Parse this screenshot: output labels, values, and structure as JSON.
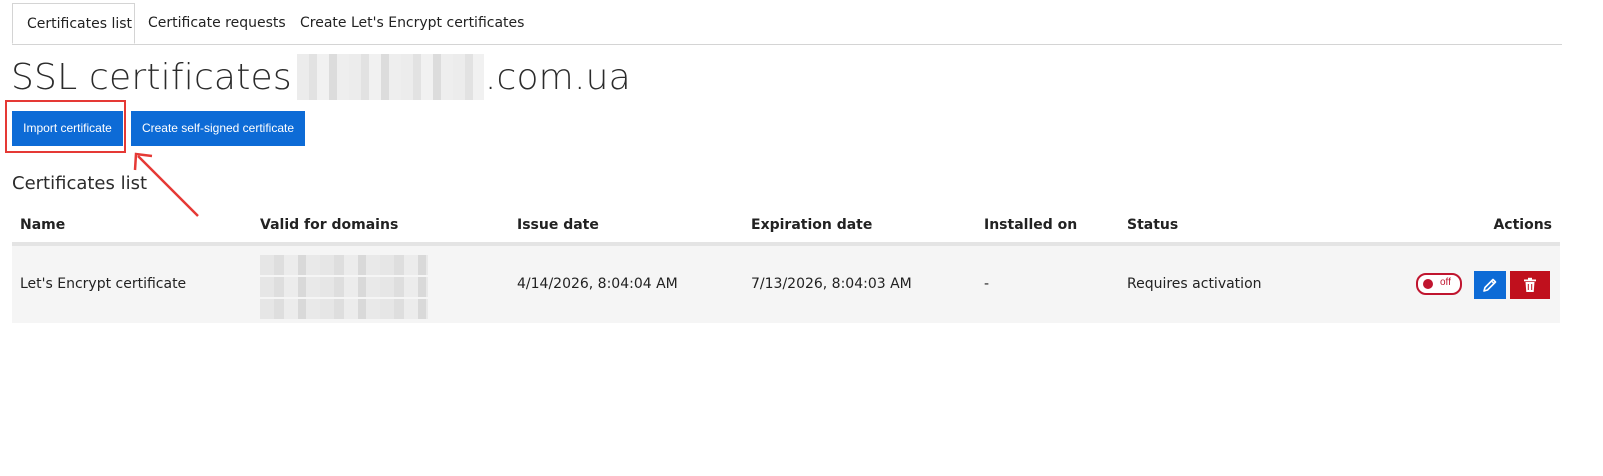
{
  "tabs": [
    {
      "label": "Certificates list",
      "active": true
    },
    {
      "label": "Certificate requests",
      "active": false
    },
    {
      "label": "Create Let's Encrypt certificates",
      "active": false
    }
  ],
  "page": {
    "title_prefix": "SSL certificates",
    "title_suffix": ".com.ua"
  },
  "buttons": {
    "import": "Import certificate",
    "self_signed": "Create self-signed certificate"
  },
  "section": {
    "title": "Certificates list"
  },
  "table": {
    "columns": [
      "Name",
      "Valid for domains",
      "Issue date",
      "Expiration date",
      "Installed on",
      "Status",
      "Actions"
    ],
    "rows": [
      {
        "name": "Let's Encrypt certificate",
        "domains": "",
        "issue_date": "4/14/2026, 8:04:04 AM",
        "expiration_date": "7/13/2026, 8:04:03 AM",
        "installed_on": "-",
        "status": "Requires activation",
        "toggle_label": "off",
        "toggle_on": false
      }
    ]
  },
  "colors": {
    "primary": "#0d6bd6",
    "danger": "#c0101d",
    "highlight": "#e53935",
    "row_bg": "#f5f5f5"
  },
  "icons": {
    "edit": "pencil-icon",
    "delete": "trash-icon"
  }
}
